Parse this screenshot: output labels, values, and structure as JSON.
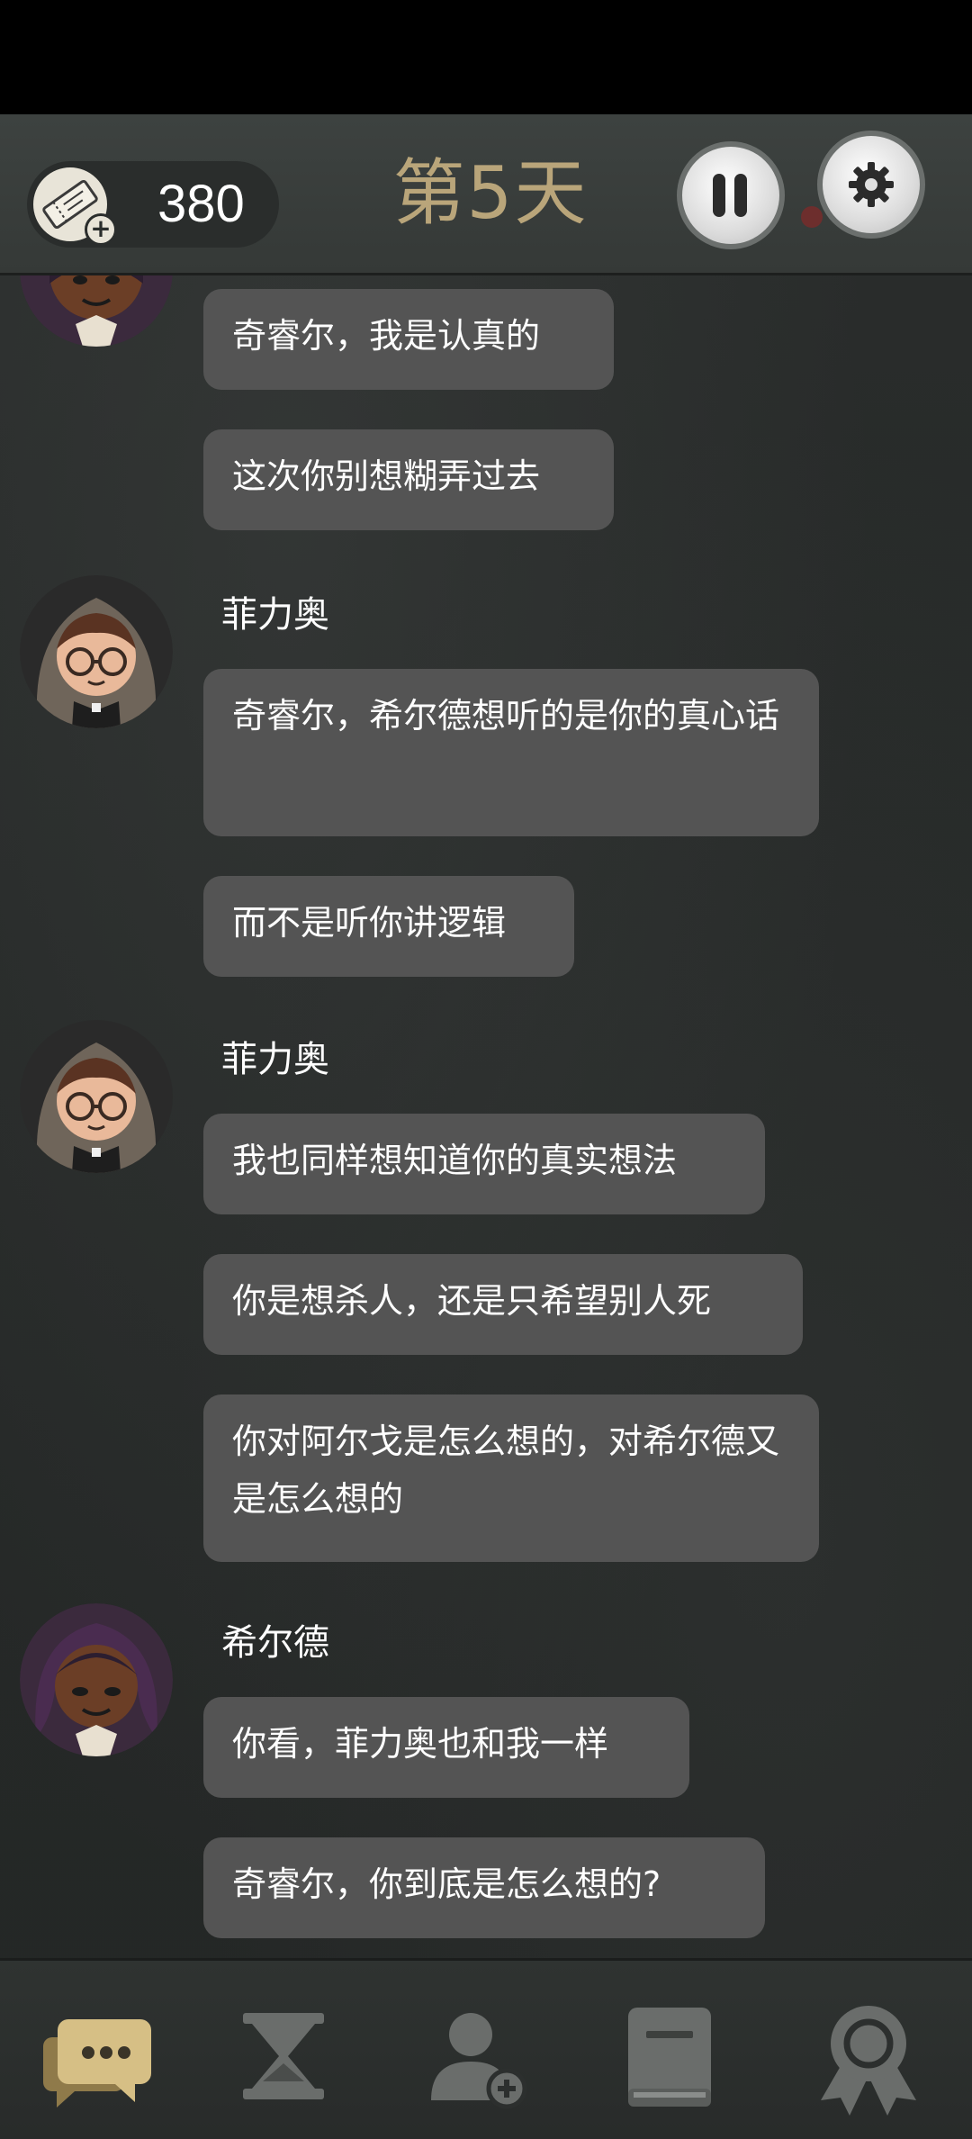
{
  "header": {
    "ticket_count": "380",
    "day_title": "第5天"
  },
  "chat": {
    "messages": [
      {
        "sender": "",
        "text": "奇睿尔，我是认真的"
      },
      {
        "sender": "",
        "text": "这次你别想糊弄过去"
      },
      {
        "sender": "菲力奥",
        "text": "奇睿尔，希尔德想听的是你的真心话"
      },
      {
        "sender": "",
        "text": "而不是听你讲逻辑"
      },
      {
        "sender": "菲力奥",
        "text": "我也同样想知道你的真实想法"
      },
      {
        "sender": "",
        "text": "你是想杀人，还是只希望别人死"
      },
      {
        "sender": "",
        "text": "你对阿尔戈是怎么想的，对希尔德又是怎么想的"
      },
      {
        "sender": "希尔德",
        "text": "你看，菲力奥也和我一样"
      },
      {
        "sender": "",
        "text": "奇睿尔，你到底是怎么想的?"
      }
    ]
  },
  "bottom_nav": {
    "items": [
      {
        "icon": "chat-bubbles-icon",
        "active": true
      },
      {
        "icon": "hourglass-icon",
        "active": false
      },
      {
        "icon": "add-person-icon",
        "active": false
      },
      {
        "icon": "book-icon",
        "active": false
      },
      {
        "icon": "award-ribbon-icon",
        "active": false
      }
    ]
  },
  "colors": {
    "accent": "#b9a57a",
    "bubble": "#545454",
    "background": "#262928"
  }
}
